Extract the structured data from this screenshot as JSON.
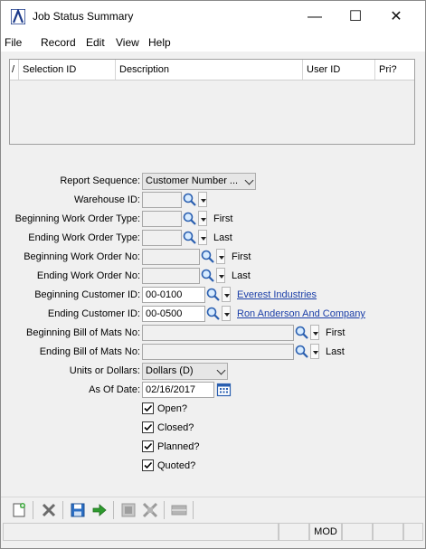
{
  "window": {
    "title": "Job Status Summary",
    "controls": {
      "minimize": "—",
      "maximize": "☐",
      "close": "✕"
    }
  },
  "menu": [
    "File",
    "Record",
    "Edit",
    "View",
    "Help"
  ],
  "grid": {
    "columns": [
      "Selection ID",
      "Description",
      "User ID",
      "Pri?"
    ],
    "rows": []
  },
  "form": {
    "report_sequence": {
      "label": "Report Sequence:",
      "value": "Customer Number ..."
    },
    "warehouse_id": {
      "label": "Warehouse ID:",
      "value": ""
    },
    "begin_wo_type": {
      "label": "Beginning Work Order Type:",
      "value": "",
      "side": "First"
    },
    "end_wo_type": {
      "label": "Ending Work Order Type:",
      "value": "",
      "side": "Last"
    },
    "begin_wo_no": {
      "label": "Beginning Work Order No:",
      "value": "",
      "side": "First"
    },
    "end_wo_no": {
      "label": "Ending Work Order No:",
      "value": "",
      "side": "Last"
    },
    "begin_cust": {
      "label": "Beginning Customer ID:",
      "value": "00-0100",
      "link": "Everest Industries"
    },
    "end_cust": {
      "label": "Ending Customer ID:",
      "value": "00-0500",
      "link": "Ron Anderson And Company"
    },
    "begin_bom": {
      "label": "Beginning Bill of Mats No:",
      "value": "",
      "side": "First"
    },
    "end_bom": {
      "label": "Ending Bill of Mats No:",
      "value": "",
      "side": "Last"
    },
    "units_or_dollars": {
      "label": "Units or Dollars:",
      "value": "Dollars (D)"
    },
    "as_of_date": {
      "label": "As Of Date:",
      "value": "02/16/2017"
    },
    "checkboxes": [
      {
        "label": "Open?",
        "checked": true
      },
      {
        "label": "Closed?",
        "checked": true
      },
      {
        "label": "Planned?",
        "checked": true
      },
      {
        "label": "Quoted?",
        "checked": true
      }
    ]
  },
  "toolbar": [
    "new-icon",
    "delete-icon",
    "save-icon",
    "go-icon",
    "first-icon",
    "last-icon",
    "bar-icon"
  ],
  "status": {
    "mode": "MOD"
  },
  "colors": {
    "link": "#1a3ea8",
    "window_bg": "#f0f0f0",
    "title_bg": "#ffffff",
    "accent": "#1c3a8a"
  }
}
